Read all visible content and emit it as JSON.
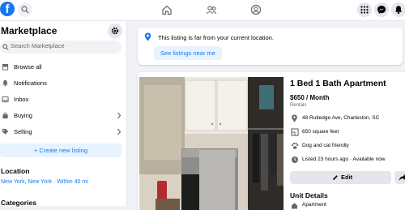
{
  "topbar": {
    "logo": "f",
    "icons": [
      "search-icon",
      "home-icon",
      "groups-icon",
      "gaming-icon",
      "menu-grid-icon",
      "messenger-icon",
      "bell-icon"
    ]
  },
  "sidebar": {
    "title": "Marketplace",
    "search_placeholder": "Search Marketplace",
    "items": [
      {
        "label": "Browse all",
        "icon": "storefront-icon"
      },
      {
        "label": "Notifications",
        "icon": "bell-icon"
      },
      {
        "label": "Inbox",
        "icon": "inbox-icon"
      },
      {
        "label": "Buying",
        "icon": "bag-icon",
        "chevron": true
      },
      {
        "label": "Selling",
        "icon": "tag-icon",
        "chevron": true
      }
    ],
    "create_label": "+ Create new listing",
    "location_heading": "Location",
    "location_value": "New York, New York · Within 40 mi",
    "categories_heading": "Categories"
  },
  "alert": {
    "message": "This listing is far from your current location.",
    "button": "See listings near me"
  },
  "listing": {
    "title": "1 Bed 1 Bath Apartment",
    "price": "$650 / Month",
    "category": "Rentals",
    "details": [
      {
        "icon": "location-icon",
        "text": "48 Rutledge Ave, Charleston, SC"
      },
      {
        "icon": "area-icon",
        "text": "650 square feet"
      },
      {
        "icon": "paw-icon",
        "text": "Dog and cat friendly"
      },
      {
        "icon": "clock-icon",
        "text": "Listed 23 hours ago · Available now"
      }
    ],
    "edit_label": "Edit",
    "unit_details_heading": "Unit Details",
    "unit_details": [
      {
        "icon": "home-icon",
        "text": "Apartment"
      }
    ]
  },
  "colors": {
    "accent": "#1877f2",
    "bg": "#f0f2f5",
    "button_bg": "#e4e6eb"
  }
}
